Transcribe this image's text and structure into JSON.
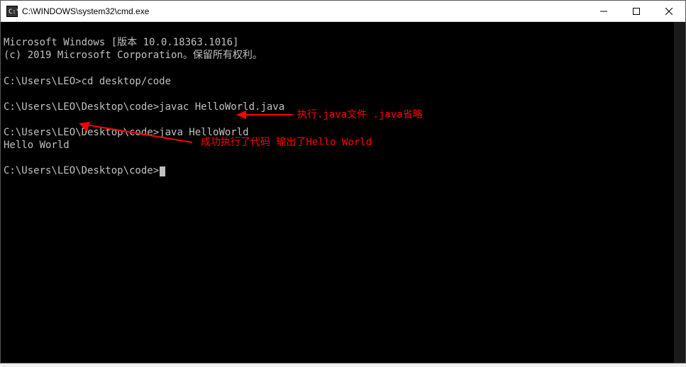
{
  "window": {
    "title": "C:\\WINDOWS\\system32\\cmd.exe",
    "icon": "cmd-icon"
  },
  "controls": {
    "minimize": "—",
    "maximize": "☐",
    "close": "✕"
  },
  "terminal": {
    "line1": "Microsoft Windows [版本 10.0.18363.1016]",
    "line2": "(c) 2019 Microsoft Corporation。保留所有权利。",
    "line3": "",
    "line4_prompt": "C:\\Users\\LEO>",
    "line4_cmd": "cd desktop/code",
    "line5": "",
    "line6_prompt": "C:\\Users\\LEO\\Desktop\\code>",
    "line6_cmd": "javac HelloWorld.java",
    "line7": "",
    "line8_prompt": "C:\\Users\\LEO\\Desktop\\code>",
    "line8_cmd": "java HelloWorld",
    "line9": "Hello World",
    "line10": "",
    "line11_prompt": "C:\\Users\\LEO\\Desktop\\code>"
  },
  "annotations": {
    "note1": "执行.java文件 .java省略",
    "note2": "成功执行了代码 输出了Hello World"
  }
}
